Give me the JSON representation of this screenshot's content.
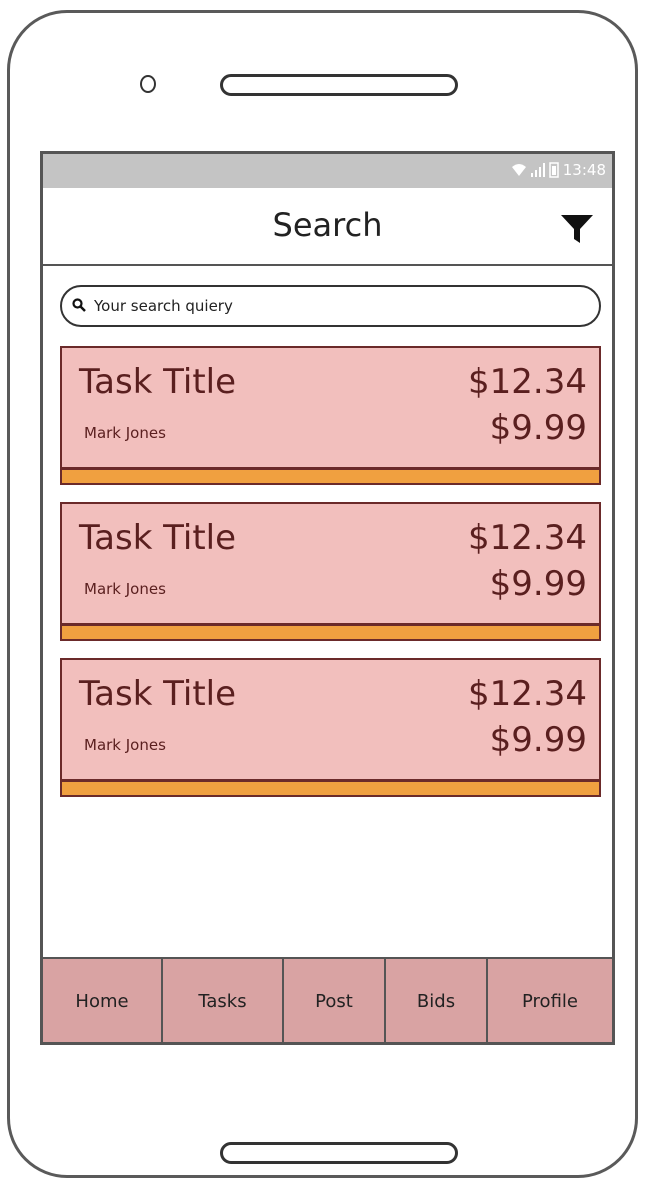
{
  "status_bar": {
    "time": "13:48",
    "icons": [
      "wifi-icon",
      "signal-icon",
      "battery-icon"
    ]
  },
  "header": {
    "title": "Search",
    "filter_icon": "filter-icon"
  },
  "search": {
    "placeholder": "Your search quiery",
    "value": ""
  },
  "tasks": [
    {
      "title": "Task Title",
      "user": "Mark Jones",
      "price": "$12.34",
      "bid": "$9.99"
    },
    {
      "title": "Task Title",
      "user": "Mark Jones",
      "price": "$12.34",
      "bid": "$9.99"
    },
    {
      "title": "Task Title",
      "user": "Mark Jones",
      "price": "$12.34",
      "bid": "$9.99"
    }
  ],
  "nav": {
    "items": [
      {
        "label": "Home"
      },
      {
        "label": "Tasks"
      },
      {
        "label": "Post"
      },
      {
        "label": "Bids"
      },
      {
        "label": "Profile"
      }
    ]
  },
  "colors": {
    "card_bg": "#f2bfbd",
    "card_border": "#6b2a2a",
    "card_accent": "#f0a040",
    "nav_bg": "#d9a3a3",
    "status_bar_bg": "#c4c4c4"
  }
}
